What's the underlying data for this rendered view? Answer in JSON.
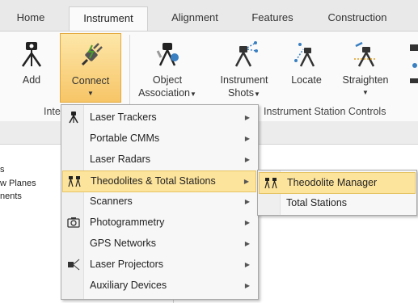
{
  "tabs": [
    {
      "label": "Home",
      "active": false
    },
    {
      "label": "Instrument",
      "active": true
    },
    {
      "label": "Alignment",
      "active": false
    },
    {
      "label": "Features",
      "active": false
    },
    {
      "label": "Construction",
      "active": false
    }
  ],
  "ribbon": {
    "add": "Add",
    "connect": "Connect",
    "object_association": [
      "Object",
      "Association"
    ],
    "instrument_shots": [
      "Instrument",
      "Shots"
    ],
    "locate": "Locate",
    "straighten": "Straighten",
    "group_left": "Inte",
    "group_right": "Instrument Station Controls"
  },
  "tree": {
    "item_1": "s",
    "item_2": "w Planes",
    "item_3": "nents"
  },
  "connect_menu": [
    {
      "label": "Laser Trackers",
      "icon": "tripod-icon",
      "submenu": true
    },
    {
      "label": "Portable CMMs",
      "icon": "",
      "submenu": true
    },
    {
      "label": "Laser Radars",
      "icon": "",
      "submenu": true
    },
    {
      "label": "Theodolites & Total Stations",
      "icon": "theodolite-icon",
      "submenu": true,
      "highlighted": true
    },
    {
      "label": "Scanners",
      "icon": "",
      "submenu": true
    },
    {
      "label": "Photogrammetry",
      "icon": "camera-icon",
      "submenu": true
    },
    {
      "label": "GPS Networks",
      "icon": "",
      "submenu": true
    },
    {
      "label": "Laser Projectors",
      "icon": "projector-icon",
      "submenu": true
    },
    {
      "label": "Auxiliary Devices",
      "icon": "",
      "submenu": true
    }
  ],
  "theodolite_submenu": [
    {
      "label": "Theodolite Manager",
      "icon": "theodolite-icon",
      "highlighted": true
    },
    {
      "label": "Total Stations",
      "icon": ""
    }
  ],
  "colors": {
    "highlight": "#fde49c",
    "highlight_border": "#e5c365",
    "connect_button": "#f7c567"
  }
}
